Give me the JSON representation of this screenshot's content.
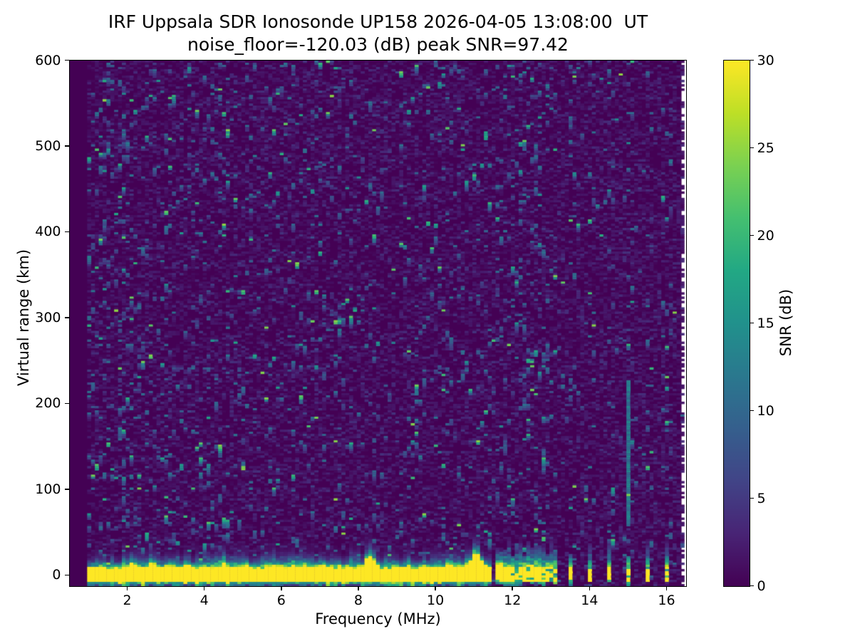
{
  "colors": {
    "figure_bg": "#ffffff",
    "axis": "#000000",
    "text": "#000000",
    "no_data_fill": "#440154"
  },
  "chart_data": {
    "type": "heatmap",
    "title": "IRF Uppsala SDR Ionosonde UP158 2026-04-05 13:08:00  UT",
    "subtitle": "noise_floor=-120.03 (dB) peak SNR=97.42",
    "xlabel": "Frequency (MHz)",
    "ylabel": "Virtual range (km)",
    "xlim": [
      0.5,
      16.5
    ],
    "ylim": [
      -12.5,
      600
    ],
    "x_ticks": [
      2,
      4,
      6,
      8,
      10,
      12,
      14,
      16
    ],
    "y_ticks": [
      0,
      100,
      200,
      300,
      400,
      500,
      600
    ],
    "grid": false,
    "colorbar": {
      "label": "SNR (dB)",
      "ticks": [
        0,
        5,
        10,
        15,
        20,
        25,
        30
      ],
      "vmin": 0,
      "vmax": 30,
      "colormap": "viridis",
      "position": "right"
    },
    "colormap_stops": [
      "#440154",
      "#482475",
      "#414487",
      "#355f8d",
      "#2a788e",
      "#21918c",
      "#22a884",
      "#44bf70",
      "#7ad151",
      "#bddf26",
      "#fde725"
    ],
    "data_extent": {
      "f_start": 0.95,
      "f_end": 16.38,
      "right_margin_blank": true
    },
    "features": {
      "ground_return_band": {
        "f_start": 0.95,
        "f_end": 11.45,
        "range_km": [
          -7,
          8
        ],
        "snr_db": 30,
        "fringe_top_km": 30
      },
      "echo_bumps": [
        {
          "f": 8.3,
          "h": 13,
          "w": 0.1
        },
        {
          "f": 11.05,
          "h": 16,
          "w": 0.13
        },
        {
          "f": 2.1,
          "h": 4,
          "w": 0.05
        },
        {
          "f": 2.65,
          "h": 5,
          "w": 0.05
        },
        {
          "f": 3.55,
          "h": 5,
          "w": 0.05
        },
        {
          "f": 4.5,
          "h": 6,
          "w": 0.05
        },
        {
          "f": 5.1,
          "h": 3,
          "w": 0.05
        },
        {
          "f": 6.35,
          "h": 4,
          "w": 0.05
        },
        {
          "f": 7.05,
          "h": 3,
          "w": 0.05
        },
        {
          "f": 10.35,
          "h": 4,
          "w": 0.07
        }
      ],
      "discrete_bars": [
        {
          "f": 11.62,
          "w": 0.07
        },
        {
          "f": 11.8,
          "w": 0.07
        },
        {
          "f": 11.98,
          "w": 0.07
        },
        {
          "f": 12.16,
          "w": 0.07
        },
        {
          "f": 12.34,
          "w": 0.07
        },
        {
          "f": 12.52,
          "w": 0.07
        },
        {
          "f": 12.7,
          "w": 0.07
        },
        {
          "f": 12.88,
          "w": 0.07
        },
        {
          "f": 13.06,
          "w": 0.07
        },
        {
          "f": 13.5,
          "w": 0.09
        },
        {
          "f": 14.0,
          "w": 0.09
        },
        {
          "f": 14.5,
          "w": 0.09
        },
        {
          "f": 15.0,
          "w": 0.09
        },
        {
          "f": 15.5,
          "w": 0.08
        },
        {
          "f": 16.0,
          "w": 0.09
        }
      ],
      "bar_range_km": [
        -7,
        8
      ],
      "noise_streak": {
        "f": 15.02,
        "range_km": [
          60,
          228
        ],
        "snr_db": 11
      },
      "background_noise_snr_db": [
        0,
        25
      ],
      "noise_density_note": "speckle denser below 3 MHz, sparse above 13 MHz except in columns above bars"
    }
  }
}
